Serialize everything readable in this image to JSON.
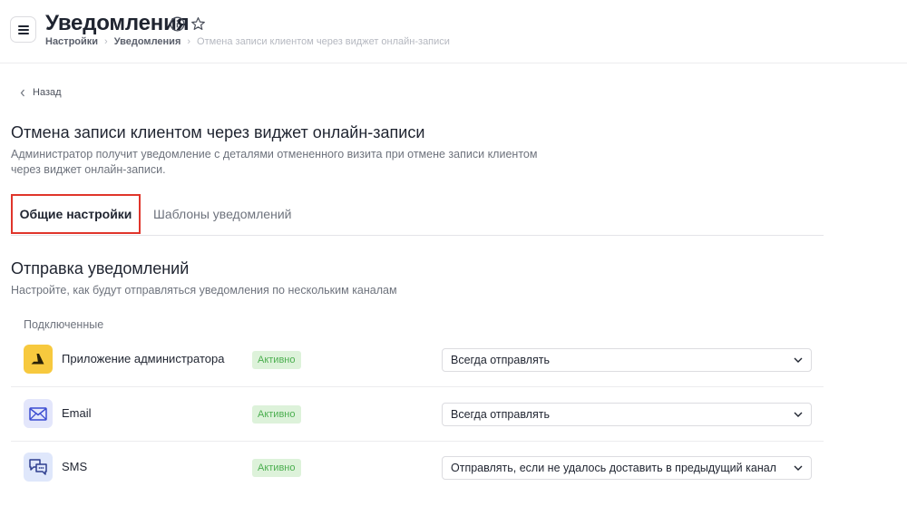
{
  "header": {
    "title": "Уведомления",
    "breadcrumb": [
      "Настройки",
      "Уведомления",
      "Отмена записи клиентом через виджет онлайн-записи"
    ]
  },
  "back": {
    "label": "Назад"
  },
  "section": {
    "title": "Отмена записи клиентом через виджет онлайн-записи",
    "description": "Администратор получит уведомление с деталями отмененного визита при отмене записи клиентом через виджет онлайн-записи."
  },
  "tabs": [
    {
      "label": "Общие настройки",
      "active": true
    },
    {
      "label": "Шаблоны уведомлений",
      "active": false
    }
  ],
  "sending": {
    "title": "Отправка уведомлений",
    "description": "Настройте, как будут отправляться уведомления по нескольким каналам",
    "connected_label": "Подключенные",
    "channels": [
      {
        "name": "Приложение администратора",
        "icon": "admin-app-icon",
        "status": "Активно",
        "mode": "Всегда отправлять"
      },
      {
        "name": "Email",
        "icon": "envelope-icon",
        "status": "Активно",
        "mode": "Всегда отправлять"
      },
      {
        "name": "SMS",
        "icon": "chat-bubbles-icon",
        "status": "Активно",
        "mode": "Отправлять, если не удалось доставить в предыдущий канал"
      }
    ]
  },
  "colors": {
    "accent_outline": "#e0352b",
    "badge_bg": "#ddf2da",
    "badge_text": "#4caf50",
    "admin_icon_bg": "#f7c93e",
    "email_icon_bg": "#e3e6fb",
    "sms_icon_bg": "#dfe7fb"
  }
}
